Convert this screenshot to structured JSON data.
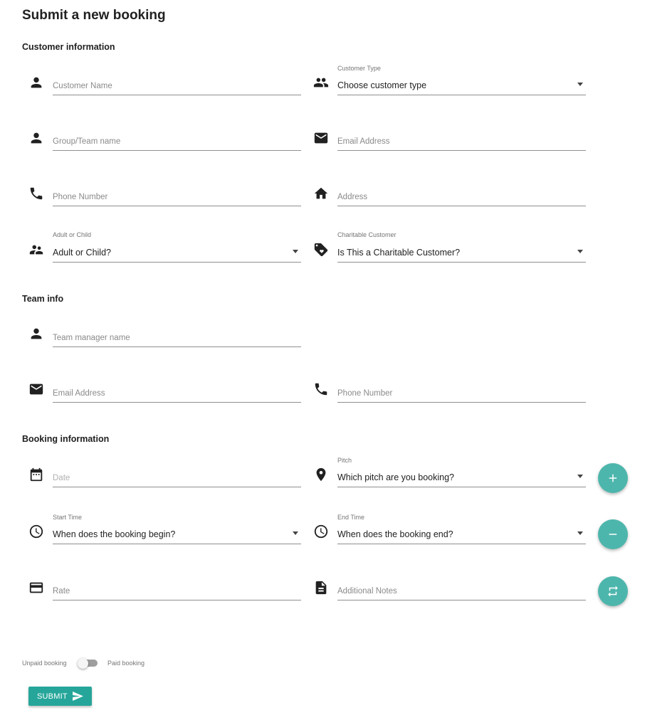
{
  "page": {
    "title": "Submit a new booking"
  },
  "sections": {
    "customer": "Customer information",
    "team": "Team info",
    "booking": "Booking information"
  },
  "customer": {
    "name": {
      "placeholder": "Customer Name",
      "icon": "person-icon"
    },
    "type": {
      "label": "Customer Type",
      "value": "Choose customer type",
      "icon": "group-icon"
    },
    "group_name": {
      "placeholder": "Group/Team name",
      "icon": "person-icon"
    },
    "email": {
      "placeholder": "Email Address",
      "icon": "email-icon"
    },
    "phone": {
      "placeholder": "Phone Number",
      "icon": "phone-icon"
    },
    "address": {
      "placeholder": "Address",
      "icon": "home-icon"
    },
    "adult_child": {
      "label": "Adult or Child",
      "value": "Adult or Child?",
      "icon": "family-icon"
    },
    "charitable": {
      "label": "Charitable Customer",
      "value": "Is This a Charitable Customer?",
      "icon": "tag-icon"
    }
  },
  "team": {
    "manager_name": {
      "placeholder": "Team manager name",
      "icon": "person-icon"
    },
    "email": {
      "placeholder": "Email Address",
      "icon": "email-icon"
    },
    "phone": {
      "placeholder": "Phone Number",
      "icon": "phone-icon"
    }
  },
  "booking": {
    "date": {
      "placeholder": "Date",
      "icon": "calendar-icon"
    },
    "pitch": {
      "label": "Pitch",
      "value": "Which pitch are you booking?",
      "icon": "location-pin-icon"
    },
    "start_time": {
      "label": "Start Time",
      "value": "When does the booking begin?",
      "icon": "clock-icon"
    },
    "end_time": {
      "label": "End Time",
      "value": "When does the booking end?",
      "icon": "clock-icon"
    },
    "rate": {
      "placeholder": "Rate",
      "icon": "credit-card-icon"
    },
    "notes": {
      "placeholder": "Additional Notes",
      "icon": "document-icon"
    },
    "fab_icons": [
      "plus-icon",
      "minus-icon",
      "swap-icon"
    ]
  },
  "payment_toggle": {
    "off_label": "Unpaid booking",
    "on_label": "Paid booking",
    "is_paid": false
  },
  "submit": {
    "label": "SUBMIT",
    "icon": "send-icon"
  },
  "colors": {
    "accent": "#26a69a",
    "fab": "#4db6ac",
    "text": "#212121",
    "underline": "#8f8f8f",
    "placeholder": "#8a8a8a"
  }
}
